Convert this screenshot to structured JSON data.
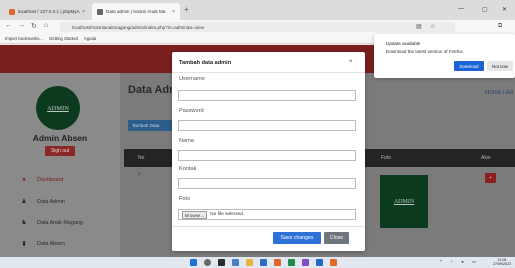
{
  "browser": {
    "tabs": [
      {
        "label": "localhost / 127.0.0.1 | phpMyA"
      },
      {
        "label": "Data admin | Nosmi Anak Ma"
      }
    ],
    "url": "localhost/nosmianakmagang/admin/index.php?m=admin&s=view",
    "bookmarks": [
      "Import bookmarks...",
      "Getting Started",
      "Agoda"
    ]
  },
  "update_popup": {
    "title": "Update available",
    "message": "Download the latest version of Firefox.",
    "download_label": "Download",
    "not_now_label": "Not now"
  },
  "sidebar": {
    "logo_text": "ADMIN",
    "admin_name": "Admin Absen",
    "signout_label": "Sign out",
    "items": [
      {
        "label": "Dashboard",
        "icon": "palette-icon"
      },
      {
        "label": "Data Admin",
        "icon": "user-icon"
      },
      {
        "label": "Data Anak Magang",
        "icon": "users-icon"
      },
      {
        "label": "Data Absen",
        "icon": "book-icon"
      }
    ]
  },
  "content": {
    "title": "Data Adm",
    "breadcrumb": "Home / Ad",
    "add_button_label": "Tambah Data",
    "table": {
      "headers": {
        "no": "No",
        "foto": "Foto",
        "aksi": "Aksi"
      },
      "rows": [
        {
          "no": "1",
          "foto_text": "ADMIN"
        }
      ]
    }
  },
  "modal": {
    "title": "Tambah data admin",
    "close_icon": "×",
    "fields": {
      "username": {
        "label": "Username",
        "value": ""
      },
      "password": {
        "label": "Password",
        "value": ""
      },
      "nama": {
        "label": "Nama",
        "value": ""
      },
      "kontak": {
        "label": "Kontak",
        "value": ""
      },
      "foto": {
        "label": "Foto",
        "browse_label": "Browse...",
        "status": "No file selected."
      }
    },
    "save_label": "Save changes",
    "close_label": "Close"
  },
  "taskbar": {
    "time": "11:08",
    "date": "27/09/2023"
  },
  "colors": {
    "topbar": "#7a1f1f",
    "primary": "#2e72d8",
    "danger": "#8d1f1f",
    "logo_bg": "#0b3a1e"
  }
}
